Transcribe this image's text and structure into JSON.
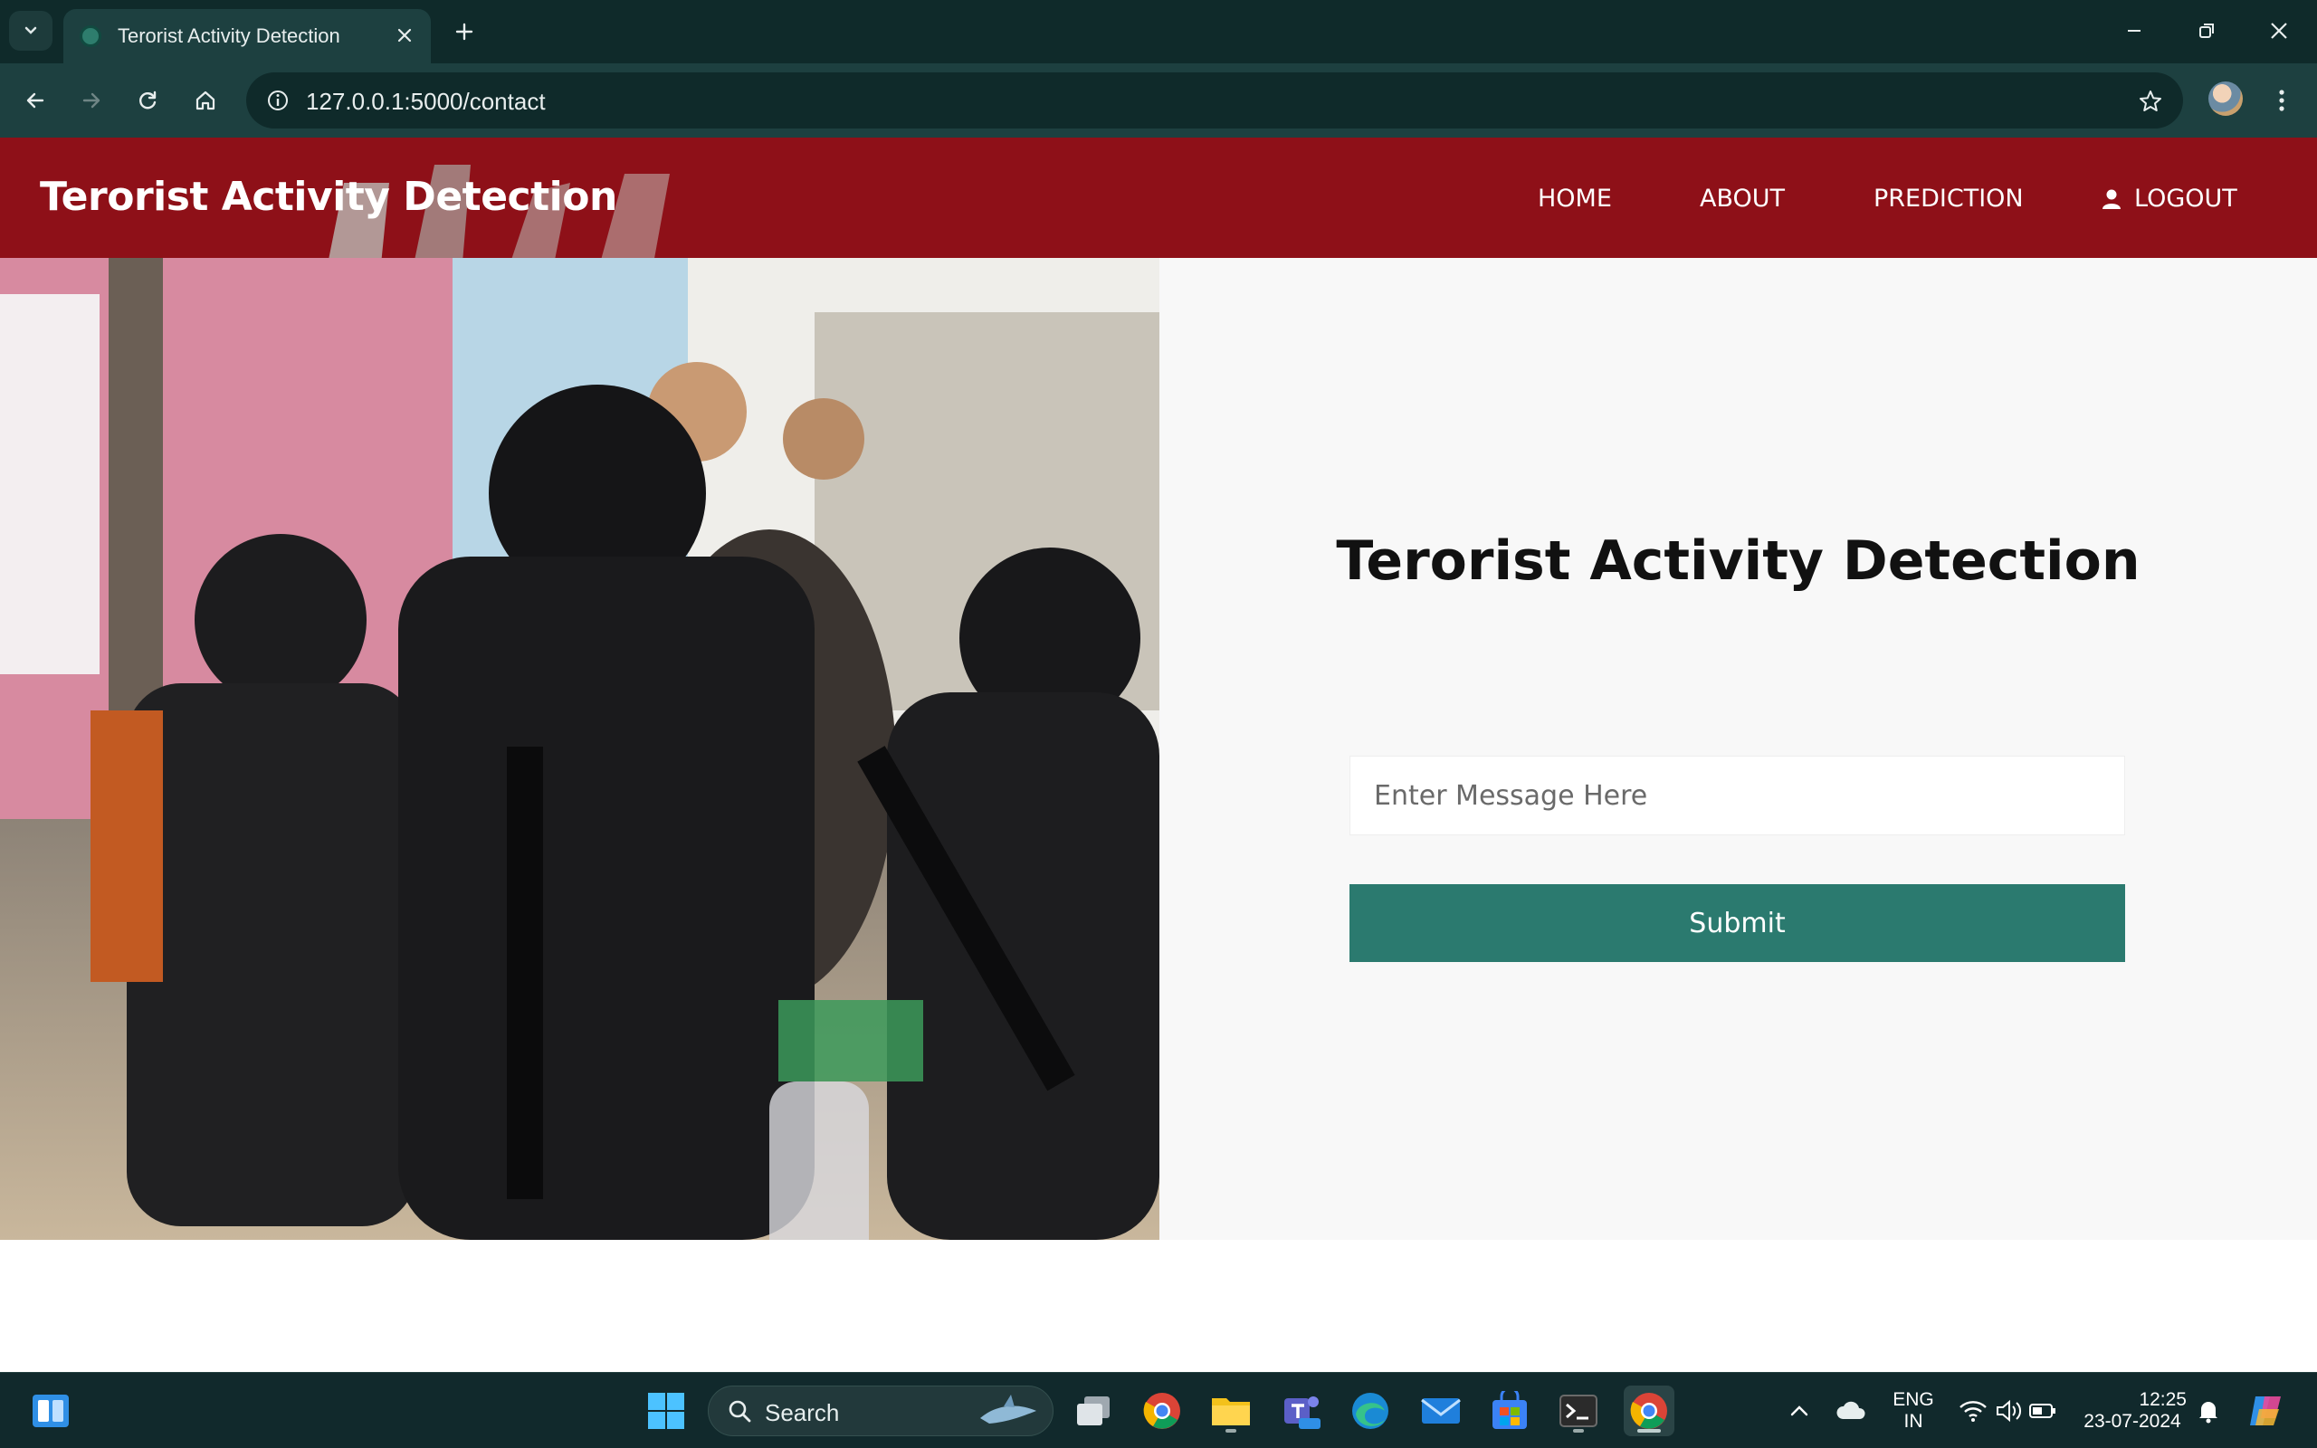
{
  "browser": {
    "tab_title": "Terorist Activity Detection",
    "url": "127.0.0.1:5000/contact"
  },
  "site": {
    "brand": "Terorist Activity Detection",
    "nav": {
      "home": "HOME",
      "about": "ABOUT",
      "prediction": "PREDICTION",
      "logout": "LOGOUT"
    },
    "hero_image_icon": "armed-police-photo",
    "form": {
      "title": "Terorist Activity Detection",
      "message_placeholder": "Enter Message Here",
      "message_value": "",
      "submit_label": "Submit"
    }
  },
  "taskbar": {
    "search_label": "Search",
    "language_line1": "ENG",
    "language_line2": "IN",
    "time": "12:25",
    "date": "23-07-2024"
  },
  "colors": {
    "nav_bg": "#8e1018",
    "submit_bg": "#2b7a6f",
    "chrome_dark": "#0f2a2a",
    "chrome_toolbar": "#1d4040",
    "taskbar_bg": "#11292c"
  }
}
